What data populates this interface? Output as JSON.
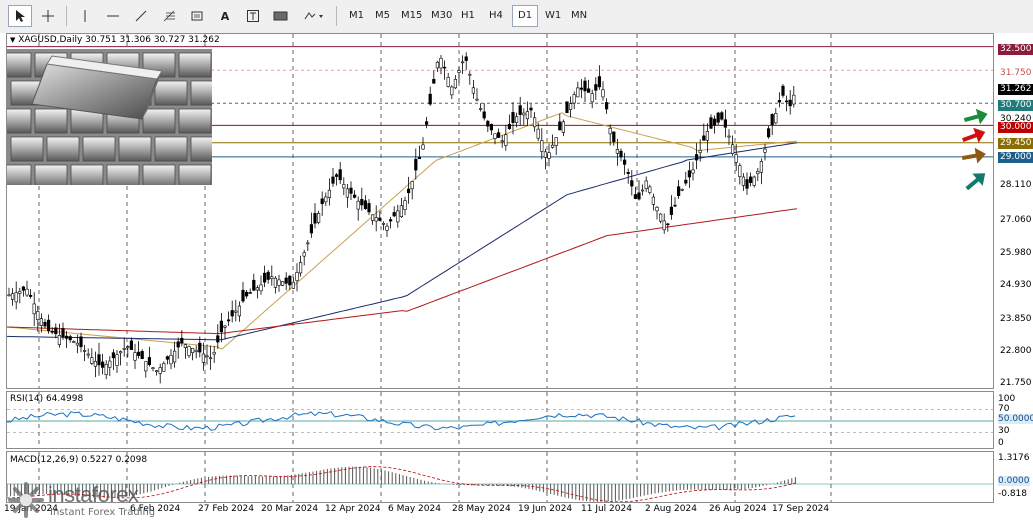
{
  "toolbar": {
    "timeframes": [
      {
        "label": "M1",
        "active": false
      },
      {
        "label": "M5",
        "active": false
      },
      {
        "label": "M15",
        "active": false
      },
      {
        "label": "M30",
        "active": false
      },
      {
        "label": "H1",
        "active": false
      },
      {
        "label": "H4",
        "active": false
      },
      {
        "label": "D1",
        "active": true
      },
      {
        "label": "W1",
        "active": false
      },
      {
        "label": "MN",
        "active": false
      }
    ],
    "tools": [
      "cursor-icon",
      "crosshair-icon",
      "vertical-line-icon",
      "horizontal-line-icon",
      "trend-line-icon",
      "fibonacci-icon",
      "channel-icon",
      "text-icon",
      "text-label-icon",
      "rectangle-icon",
      "shapes-dropdown-icon"
    ]
  },
  "chart": {
    "symbol_header": "XAGUSD,Daily  30.751 31.306 30.727 31.262",
    "price_labels": [
      {
        "text": "32.500",
        "bg": "#8b1c3b",
        "fg": "#ffffff"
      },
      {
        "text": "31.750",
        "bg": "#ffffff",
        "fg": "#c85050"
      },
      {
        "text": "31.262",
        "bg": "#000000",
        "fg": "#ffffff"
      },
      {
        "text": "30.700",
        "bg": "#1f7a7a",
        "fg": "#ffffff"
      },
      {
        "text": "30.240",
        "bg": "#ffffff",
        "fg": "#000000"
      },
      {
        "text": "30.000",
        "bg": "#c00000",
        "fg": "#ffffff"
      },
      {
        "text": "29.450",
        "bg": "#8b6d00",
        "fg": "#ffffff"
      },
      {
        "text": "29.000",
        "bg": "#1f5f8b",
        "fg": "#ffffff"
      },
      {
        "text": "28.110",
        "bg": "#ffffff",
        "fg": "#000000"
      },
      {
        "text": "27.060",
        "bg": "#ffffff",
        "fg": "#000000"
      },
      {
        "text": "25.980",
        "bg": "#ffffff",
        "fg": "#000000"
      },
      {
        "text": "24.930",
        "bg": "#ffffff",
        "fg": "#000000"
      },
      {
        "text": "23.850",
        "bg": "#ffffff",
        "fg": "#000000"
      },
      {
        "text": "22.800",
        "bg": "#ffffff",
        "fg": "#000000"
      },
      {
        "text": "21.750",
        "bg": "#ffffff",
        "fg": "#000000"
      }
    ],
    "levels": {
      "resistance_top": 32.5,
      "resistance_mid": 31.75,
      "level_1": 30.7,
      "level_2": 30.0,
      "level_3": 29.45,
      "level_4": 29.0
    },
    "arrows": [
      {
        "name": "green-arrow-icon",
        "color": "#1a8c3a"
      },
      {
        "name": "red-arrow-icon",
        "color": "#d01010"
      },
      {
        "name": "brown-arrow-icon",
        "color": "#8b5a14"
      },
      {
        "name": "teal-arrow-icon",
        "color": "#127a6a"
      }
    ],
    "colors": {
      "bull": "#000000",
      "bear": "#000000",
      "ma_fast": "#c8a050",
      "ma_mid": "#1a2a6a",
      "ma_slow": "#b01a1a"
    }
  },
  "rsi": {
    "legend": "RSI(14) 64.4998",
    "axis": [
      "100",
      "70",
      "50.0000",
      "30",
      "0"
    ]
  },
  "macd": {
    "legend": "MACD(12,26,9) 0.5227 0.2098",
    "axis": [
      "1.3176",
      "0.0000",
      "-0.818"
    ]
  },
  "dates": [
    "19 Jan 2024",
    "6 Feb 2024",
    "27 Feb 2024",
    "20 Mar 2024",
    "12 Apr 2024",
    "6 May 2024",
    "28 May 2024",
    "19 Jun 2024",
    "11 Jul 2024",
    "2 Aug 2024",
    "26 Aug 2024",
    "17 Sep 2024"
  ],
  "watermark": {
    "brand": "instaforex",
    "tagline": "Instant Forex Trading"
  }
}
